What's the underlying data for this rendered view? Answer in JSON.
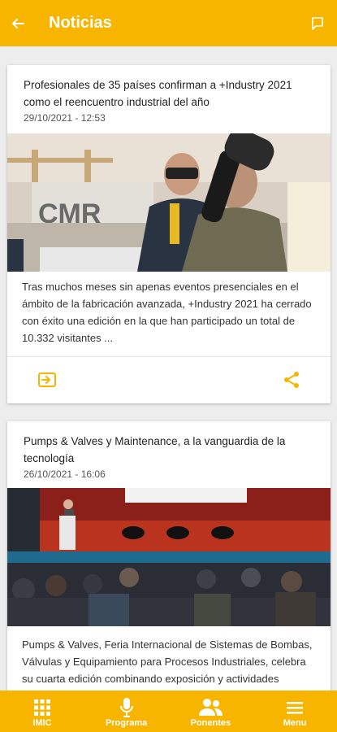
{
  "appbar": {
    "title": "Noticias",
    "back_icon": "arrow-left-icon",
    "action_icon": "flag-icon"
  },
  "news": [
    {
      "title": "Profesionales de 35 países confirman a +Industry 2021 como el reencuentro industrial del año",
      "date": "29/10/2021 - 12:53",
      "image": "conference-panel-photo",
      "excerpt": "Tras muchos meses sin apenas eventos presenciales en el ámbito de la fabricación avanzada, +Industry 2021 ha cerrado con éxito una edición en la que han participado un total de 10.332 visitantes ..."
    },
    {
      "title": "Pumps & Valves y Maintenance, a la vanguardia de la tecnología",
      "date": "26/10/2021 - 16:06",
      "image": "auditorium-talk-photo",
      "excerpt": "Pumps & Valves, Feria Internacional de Sistemas de Bombas, Válvulas y Equipamiento para Procesos Industriales, celebra su cuarta edición combinando exposición y actividades paralelas entre las"
    }
  ],
  "bottom_nav": [
    {
      "label": "IMIC",
      "icon": "grid-icon"
    },
    {
      "label": "Programa",
      "icon": "microphone-icon"
    },
    {
      "label": "Ponentes",
      "icon": "people-icon"
    },
    {
      "label": "Menu",
      "icon": "menu-icon"
    }
  ],
  "colors": {
    "accent": "#f7b500",
    "background": "#ededed"
  }
}
